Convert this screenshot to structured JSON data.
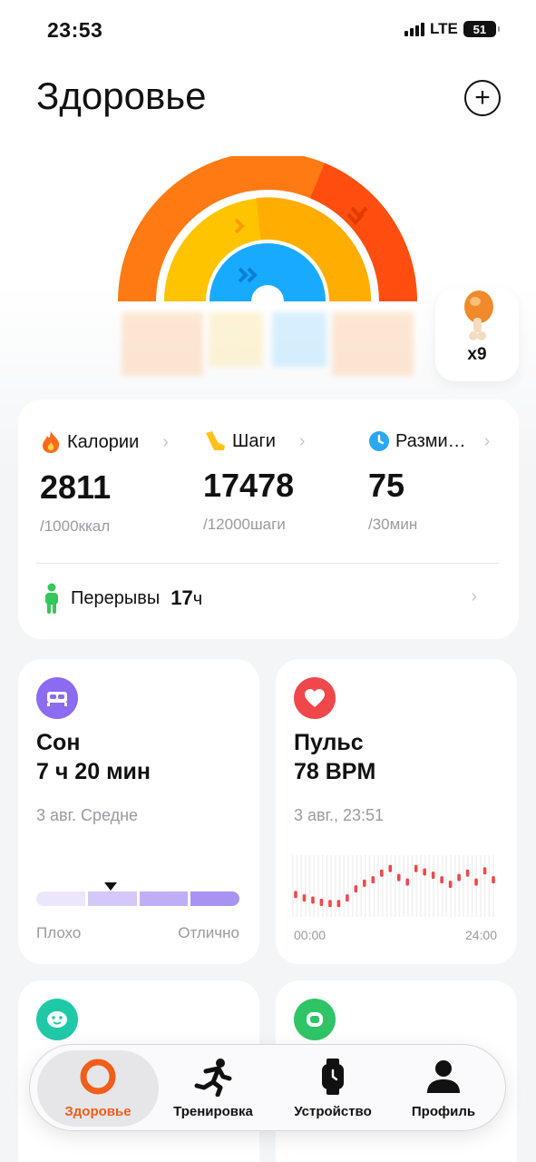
{
  "status_bar": {
    "time": "23:53",
    "network": "LTE",
    "battery": "51"
  },
  "header": {
    "title": "Здоровье",
    "add_icon": "plus-circle-icon"
  },
  "food": {
    "icon": "drumstick-icon",
    "count": "x9"
  },
  "activity": {
    "calories": {
      "label": "Калории",
      "value": "2811",
      "goal": "/1000ккал",
      "icon": "flame-icon",
      "color": "#ff6a1a"
    },
    "steps": {
      "label": "Шаги",
      "value": "17478",
      "goal": "/12000шаги",
      "icon": "shoe-icon",
      "color": "#ffc21a"
    },
    "warmup": {
      "label": "Разми…",
      "value": "75",
      "goal": "/30мин",
      "icon": "clock-icon",
      "color": "#2aa8f2"
    },
    "breaks": {
      "label": "Перерывы",
      "value": "17",
      "unit": "ч",
      "icon": "standing-person-icon",
      "color": "#34c759"
    }
  },
  "rings": {
    "outer_color": "#ff7a12",
    "middle_color": "#ffb300",
    "inner_color": "#18aaff",
    "outer_progress": 1.0,
    "middle_progress": 1.0,
    "inner_progress": 1.0
  },
  "sleep": {
    "icon": "bed-icon",
    "title": "Сон",
    "value": "7 ч 20 мин",
    "sub": "3 авг. Средне",
    "low_label": "Плохо",
    "high_label": "Отлично",
    "accent": "#8b6cf0"
  },
  "pulse": {
    "icon": "heart-icon",
    "title": "Пульс",
    "value": "78 BPM",
    "sub": "3 авг., 23:51",
    "x_start": "00:00",
    "x_end": "24:00",
    "accent": "#f0474b",
    "chart_data": {
      "type": "line",
      "x": [
        0,
        1,
        2,
        3,
        4,
        5,
        6,
        7,
        8,
        9,
        10,
        11,
        12,
        13,
        14,
        15,
        16,
        17,
        18,
        19,
        20,
        21,
        22,
        23
      ],
      "values": [
        65,
        62,
        60,
        58,
        57,
        57,
        62,
        70,
        75,
        78,
        84,
        88,
        80,
        76,
        88,
        85,
        82,
        78,
        74,
        80,
        84,
        76,
        86,
        78
      ],
      "ylim": [
        50,
        95
      ]
    }
  },
  "stress": {
    "icon": "face-icon",
    "accent": "#1fc9a8"
  },
  "spo2": {
    "icon": "lungs-icon",
    "accent": "#2fc466"
  },
  "tabbar": {
    "items": [
      {
        "label": "Здоровье",
        "icon": "ring-icon",
        "active": true
      },
      {
        "label": "Тренировка",
        "icon": "running-icon",
        "active": false
      },
      {
        "label": "Устройство",
        "icon": "watch-icon",
        "active": false
      },
      {
        "label": "Профиль",
        "icon": "person-icon",
        "active": false
      }
    ]
  }
}
